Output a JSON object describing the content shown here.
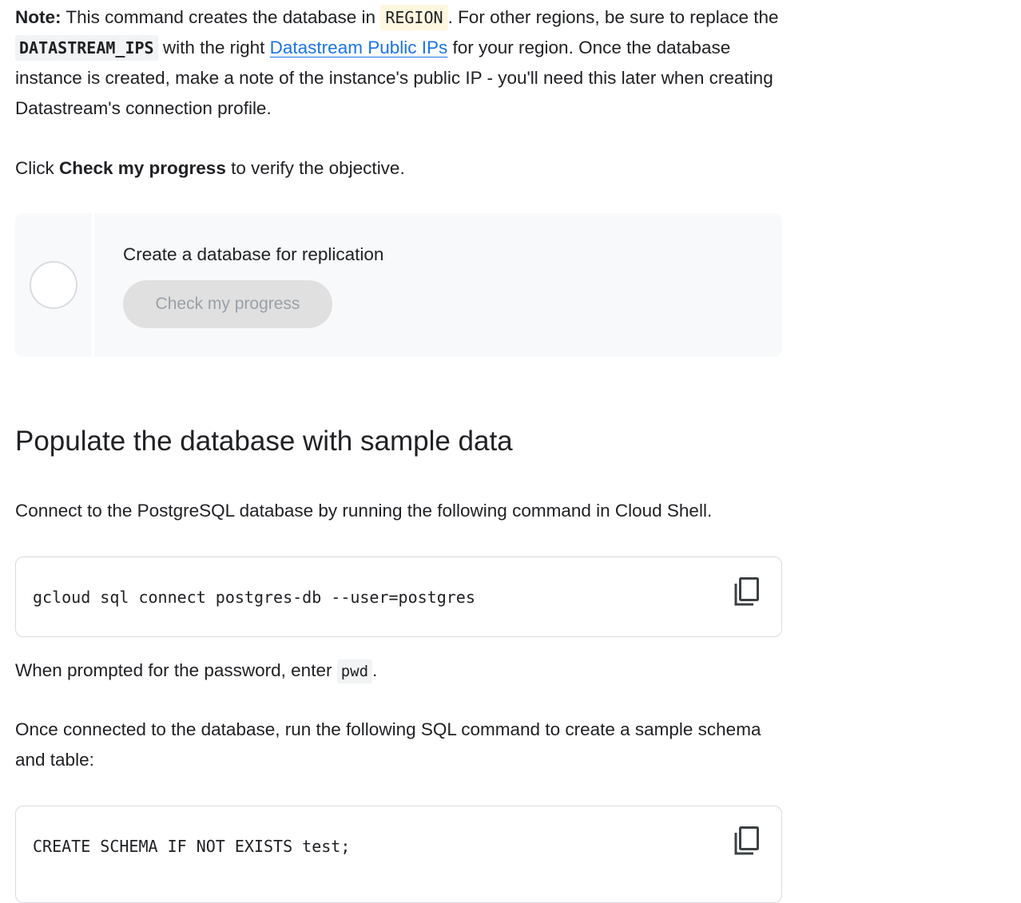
{
  "note": {
    "label": "Note:",
    "text_1": " This command creates the database in ",
    "region_code": "REGION",
    "text_2": ". For other regions, be sure to replace the ",
    "ips_code": "DATASTREAM_IPS",
    "text_3": " with the right ",
    "link_text": "Datastream Public IPs",
    "text_4": " for your region. Once the database instance is created, make a note of the instance's public IP - you'll need this later when creating Datastream's connection profile."
  },
  "click_instruction": {
    "prefix": "Click ",
    "bold": "Check my progress",
    "suffix": " to verify the objective."
  },
  "progress_card": {
    "objective_title": "Create a database for replication",
    "button_label": "Check my progress"
  },
  "section": {
    "heading": "Populate the database with sample data",
    "connect_text": "Connect to the PostgreSQL database by running the following command in Cloud Shell.",
    "code_1": "gcloud sql connect postgres-db --user=postgres",
    "pwd_prefix": "When prompted for the password, enter ",
    "pwd_code": "pwd",
    "pwd_suffix": ".",
    "once_text": "Once connected to the database, run the following SQL command to create a sample schema and table:",
    "code_2": "CREATE SCHEMA IF NOT EXISTS test;"
  },
  "icons": {
    "copy": "copy-icon"
  },
  "colors": {
    "link": "#1a73e8",
    "region_highlight": "#fef7e0",
    "code_background": "#f1f3f4",
    "card_background": "#f8f9fa",
    "button_disabled": "#e0e0e0"
  }
}
